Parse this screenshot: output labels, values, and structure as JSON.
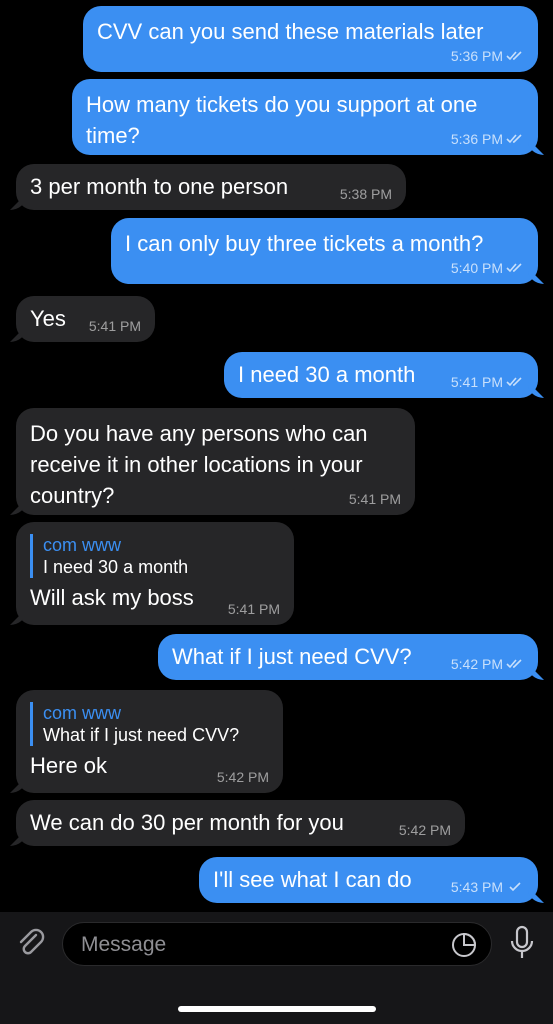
{
  "messages": [
    {
      "dir": "out",
      "text": "CVV can you send these materials later",
      "time": "5:36 PM",
      "read": true
    },
    {
      "dir": "out",
      "text": "How many tickets do you support at one time?",
      "time": "5:36 PM",
      "read": true
    },
    {
      "dir": "in",
      "text": "3 per month to one person",
      "time": "5:38 PM"
    },
    {
      "dir": "out",
      "text": "I can only buy three tickets a month?",
      "time": "5:40 PM",
      "read": true
    },
    {
      "dir": "in",
      "text": "Yes",
      "time": "5:41 PM"
    },
    {
      "dir": "out",
      "text": "I need 30 a month",
      "time": "5:41 PM",
      "read": true
    },
    {
      "dir": "in",
      "text": "Do you have any persons who can receive it in other locations in your country?",
      "time": "5:41 PM"
    },
    {
      "dir": "in",
      "reply_name": "com www",
      "reply_text": "I need 30 a month",
      "text": "Will ask my boss",
      "time": "5:41 PM"
    },
    {
      "dir": "out",
      "text": "What if I just need CVV?",
      "time": "5:42 PM",
      "read": true
    },
    {
      "dir": "in",
      "reply_name": "com www",
      "reply_text": "What if I just need CVV?",
      "text": "Here ok",
      "time": "5:42 PM"
    },
    {
      "dir": "in",
      "text": "We can do 30 per month for you",
      "time": "5:42 PM"
    },
    {
      "dir": "out",
      "text": "I'll see what I can do",
      "time": "5:43 PM",
      "read": false
    }
  ],
  "composer": {
    "placeholder": "Message"
  },
  "colors": {
    "outgoing": "#3b8ff2",
    "incoming": "#262628",
    "background": "#000000"
  },
  "icons": {
    "attach": "paperclip-icon",
    "sticker": "sticker-icon",
    "mic": "microphone-icon"
  }
}
